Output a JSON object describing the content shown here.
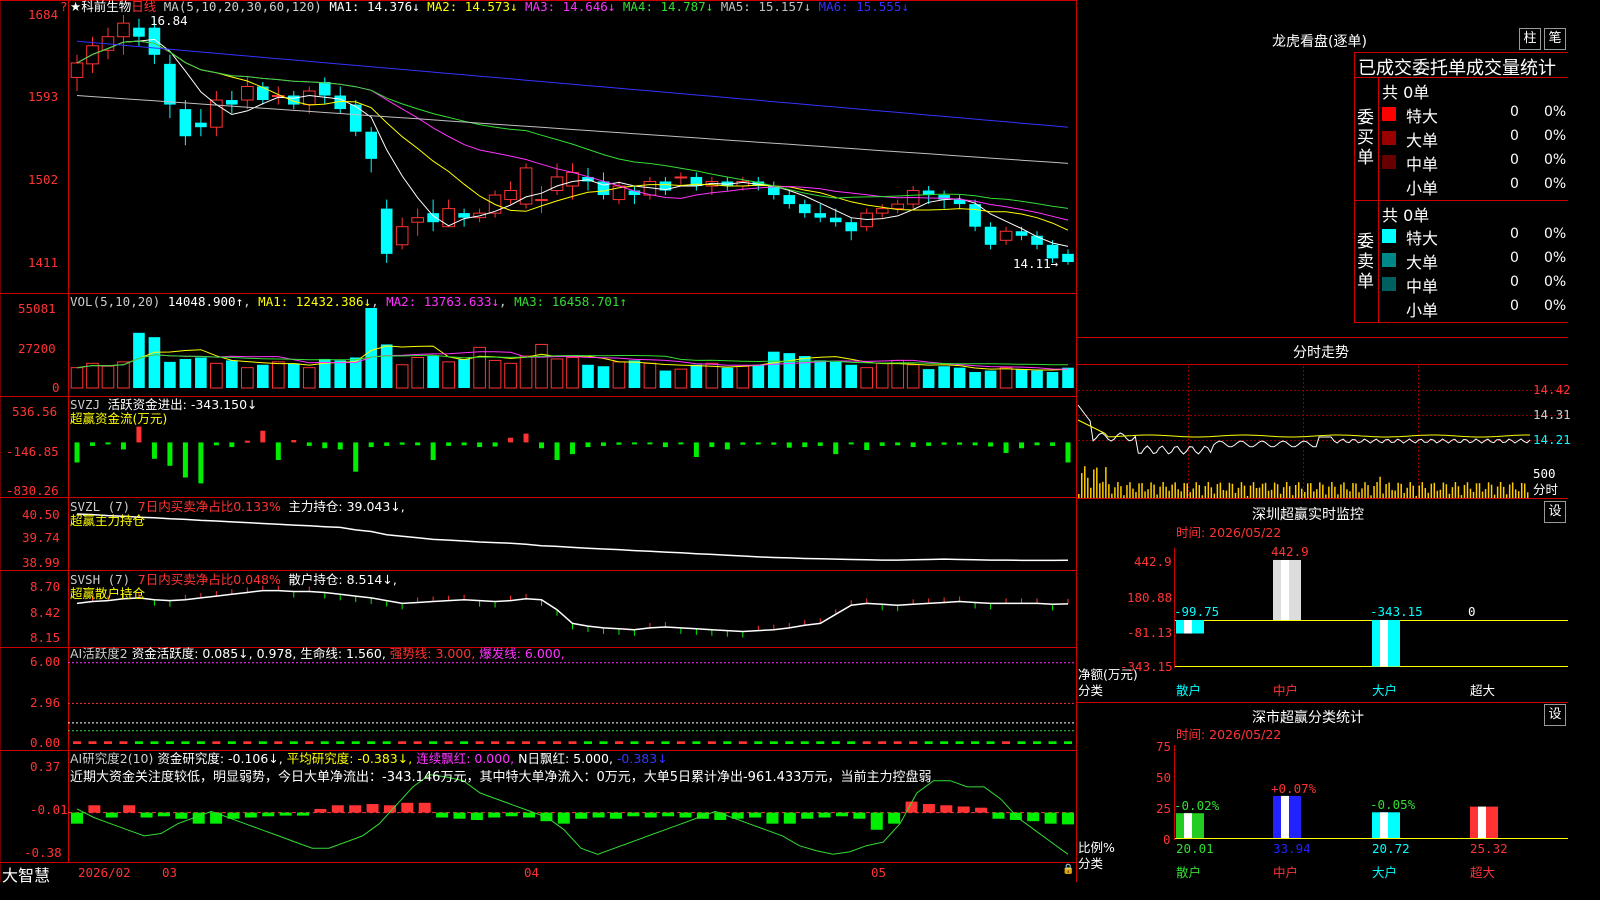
{
  "colors": {
    "up": "#ff3333",
    "down": "#00ffff",
    "ma1": "#ffffff",
    "ma2": "#ffff00",
    "ma3": "#ff33ff",
    "ma4": "#33dd33",
    "ma5": "#c0c0c0",
    "ma6": "#3333ff",
    "frame": "#cc0000",
    "green": "#00ee00"
  },
  "price_panel": {
    "title": "★科前生物",
    "period": "日线",
    "ma_header": "MA(5,10,20,30,60,120)",
    "ma": [
      {
        "label": "MA1: 14.376↓",
        "color": "#ffffff"
      },
      {
        "label": "MA2: 14.573↓",
        "color": "#ffff00"
      },
      {
        "label": "MA3: 14.646↓",
        "color": "#ff33ff"
      },
      {
        "label": "MA4: 14.787↓",
        "color": "#33dd33"
      },
      {
        "label": "MA5: 15.157↓",
        "color": "#c0c0c0"
      },
      {
        "label": "MA6: 15.555↓",
        "color": "#3333ff"
      }
    ],
    "y_ticks": [
      "1684",
      "1593",
      "1502",
      "1411"
    ],
    "high_marker": "16.84",
    "last_marker": "14.11→",
    "y_range": [
      14.11,
      16.84
    ]
  },
  "candles": [
    [
      16.15,
      16.31,
      16.0,
      16.4
    ],
    [
      16.3,
      16.5,
      16.2,
      16.6
    ],
    [
      16.45,
      16.6,
      16.35,
      16.7
    ],
    [
      16.6,
      16.75,
      16.4,
      16.84
    ],
    [
      16.7,
      16.6,
      16.5,
      16.8
    ],
    [
      16.7,
      16.4,
      16.3,
      16.8
    ],
    [
      16.3,
      15.85,
      15.7,
      16.4
    ],
    [
      15.8,
      15.5,
      15.4,
      15.9
    ],
    [
      15.65,
      15.6,
      15.5,
      15.8
    ],
    [
      15.6,
      15.9,
      15.5,
      16.0
    ],
    [
      15.9,
      15.85,
      15.75,
      16.0
    ],
    [
      15.9,
      16.05,
      15.8,
      16.15
    ],
    [
      16.05,
      15.9,
      15.85,
      16.1
    ],
    [
      15.95,
      15.95,
      15.85,
      16.05
    ],
    [
      15.95,
      15.85,
      15.8,
      16.0
    ],
    [
      15.85,
      16.0,
      15.75,
      16.05
    ],
    [
      16.1,
      15.95,
      15.85,
      16.15
    ],
    [
      15.95,
      15.8,
      15.75,
      16.05
    ],
    [
      15.85,
      15.55,
      15.5,
      15.9
    ],
    [
      15.55,
      15.25,
      15.1,
      15.6
    ],
    [
      14.7,
      14.2,
      14.1,
      14.8
    ],
    [
      14.3,
      14.5,
      14.25,
      14.6
    ],
    [
      14.55,
      14.6,
      14.4,
      14.7
    ],
    [
      14.65,
      14.55,
      14.45,
      14.8
    ],
    [
      14.5,
      14.7,
      14.5,
      14.8
    ],
    [
      14.65,
      14.6,
      14.5,
      14.7
    ],
    [
      14.6,
      14.65,
      14.55,
      14.7
    ],
    [
      14.65,
      14.85,
      14.6,
      14.9
    ],
    [
      14.8,
      14.9,
      14.75,
      15.0
    ],
    [
      14.75,
      15.15,
      14.7,
      15.2
    ],
    [
      14.8,
      14.8,
      14.65,
      14.95
    ],
    [
      14.9,
      15.05,
      14.85,
      15.2
    ],
    [
      14.95,
      15.1,
      14.8,
      15.2
    ],
    [
      15.05,
      15.0,
      14.9,
      15.15
    ],
    [
      15.0,
      14.85,
      14.8,
      15.1
    ],
    [
      14.8,
      14.95,
      14.75,
      15.0
    ],
    [
      14.9,
      14.85,
      14.75,
      14.95
    ],
    [
      14.85,
      15.0,
      14.8,
      15.05
    ],
    [
      15.0,
      14.9,
      14.85,
      15.05
    ],
    [
      15.05,
      15.05,
      14.95,
      15.1
    ],
    [
      15.05,
      14.95,
      14.9,
      15.1
    ],
    [
      14.95,
      15.0,
      14.85,
      15.05
    ],
    [
      15.0,
      14.95,
      14.9,
      15.05
    ],
    [
      14.95,
      15.0,
      14.9,
      15.05
    ],
    [
      15.0,
      14.95,
      14.9,
      15.05
    ],
    [
      14.95,
      14.85,
      14.8,
      15.0
    ],
    [
      14.85,
      14.75,
      14.7,
      14.9
    ],
    [
      14.75,
      14.65,
      14.6,
      14.8
    ],
    [
      14.65,
      14.6,
      14.55,
      14.75
    ],
    [
      14.6,
      14.55,
      14.5,
      14.7
    ],
    [
      14.55,
      14.45,
      14.35,
      14.6
    ],
    [
      14.5,
      14.65,
      14.45,
      14.7
    ],
    [
      14.65,
      14.7,
      14.6,
      14.75
    ],
    [
      14.7,
      14.75,
      14.65,
      14.8
    ],
    [
      14.75,
      14.9,
      14.7,
      14.95
    ],
    [
      14.9,
      14.85,
      14.75,
      14.95
    ],
    [
      14.85,
      14.8,
      14.7,
      14.9
    ],
    [
      14.8,
      14.75,
      14.7,
      14.85
    ],
    [
      14.75,
      14.5,
      14.45,
      14.8
    ],
    [
      14.5,
      14.3,
      14.25,
      14.55
    ],
    [
      14.35,
      14.45,
      14.3,
      14.5
    ],
    [
      14.45,
      14.4,
      14.35,
      14.5
    ],
    [
      14.4,
      14.3,
      14.25,
      14.45
    ],
    [
      14.3,
      14.15,
      14.1,
      14.35
    ],
    [
      14.2,
      14.11,
      14.08,
      14.25
    ]
  ],
  "vol_panel": {
    "title": "VOL(5,10,20)",
    "v0": "14048.900↑",
    "ma1": "MA1: 12432.386↓",
    "ma2": "MA2: 13763.633↓",
    "ma3": "MA3: 16458.701↑",
    "y_ticks": [
      "55081",
      "27200",
      "0"
    ],
    "y_max": 55081,
    "values": [
      14000,
      17000,
      15000,
      18000,
      38000,
      35000,
      18000,
      20000,
      21000,
      17000,
      19000,
      14000,
      16000,
      18000,
      17000,
      14000,
      20000,
      19000,
      21000,
      55081,
      30000,
      16000,
      21000,
      22000,
      18000,
      20000,
      28000,
      19000,
      17000,
      22000,
      30000,
      20000,
      21000,
      16000,
      15000,
      18000,
      19000,
      17000,
      12000,
      13000,
      16000,
      17000,
      14000,
      15000,
      16000,
      25000,
      24000,
      22000,
      19000,
      18000,
      16000,
      14000,
      17000,
      19000,
      16000,
      13000,
      15000,
      14000,
      11000,
      12000,
      14000,
      13000,
      12000,
      11000,
      14000
    ]
  },
  "svzj": {
    "title": "SVZJ",
    "sub": "活跃资金进出: -343.150↓",
    "label": "超赢资金流(万元)",
    "y_ticks": [
      "536.56",
      "-146.85",
      "-830.26"
    ],
    "y_range": [
      -830.26,
      536.56
    ],
    "values": [
      -343,
      -60,
      -30,
      -120,
      270,
      -280,
      -400,
      -600,
      -700,
      -50,
      -80,
      30,
      200,
      -300,
      40,
      -60,
      -100,
      -120,
      -500,
      -80,
      -60,
      -40,
      -50,
      -300,
      -60,
      -50,
      -80,
      -70,
      80,
      150,
      -100,
      -300,
      -200,
      -80,
      -60,
      -40,
      -30,
      -30,
      -80,
      -30,
      -250,
      -80,
      -120,
      -40,
      -20,
      -40,
      -90,
      -80,
      -60,
      -200,
      -30,
      -130,
      -60,
      -50,
      -80,
      -60,
      -40,
      -40,
      -50,
      -70,
      -180,
      -100,
      -50,
      -60,
      -343
    ]
  },
  "svzl": {
    "title": "SVZL (7)",
    "sub1": "7日内买卖净占比0.133%",
    "sub2": "主力持仓: 39.043↓,",
    "label": "超赢主力持仓",
    "y_ticks": [
      "40.50",
      "39.74",
      "38.99"
    ],
    "y_range": [
      38.99,
      40.5
    ],
    "values": [
      40.5,
      40.48,
      40.45,
      40.43,
      40.4,
      40.38,
      40.35,
      40.33,
      40.3,
      40.28,
      40.25,
      40.23,
      40.2,
      40.18,
      40.15,
      40.13,
      40.1,
      40.08,
      40.0,
      39.95,
      39.85,
      39.8,
      39.75,
      39.7,
      39.68,
      39.65,
      39.62,
      39.6,
      39.58,
      39.55,
      39.5,
      39.48,
      39.45,
      39.42,
      39.4,
      39.38,
      39.35,
      39.33,
      39.3,
      39.28,
      39.25,
      39.23,
      39.2,
      39.18,
      39.15,
      39.13,
      39.12,
      39.1,
      39.09,
      39.08,
      39.07,
      39.06,
      39.05,
      39.05,
      39.06,
      39.07,
      39.08,
      39.07,
      39.06,
      39.05,
      39.05,
      39.04,
      39.04,
      39.04,
      39.043
    ]
  },
  "svsh": {
    "title": "SVSH (7)",
    "sub1": "7日内买卖净占比0.048%",
    "sub2": "散户持仓: 8.514↓,",
    "label": "超赢散户持仓",
    "y_ticks": [
      "8.70",
      "8.42",
      "8.15"
    ],
    "y_range": [
      8.15,
      8.7
    ],
    "values": [
      8.52,
      8.54,
      8.55,
      8.57,
      8.58,
      8.56,
      8.55,
      8.56,
      8.58,
      8.6,
      8.62,
      8.64,
      8.66,
      8.66,
      8.65,
      8.65,
      8.64,
      8.62,
      8.6,
      8.58,
      8.55,
      8.52,
      8.53,
      8.54,
      8.55,
      8.56,
      8.55,
      8.54,
      8.55,
      8.57,
      8.56,
      8.45,
      8.3,
      8.27,
      8.25,
      8.24,
      8.23,
      8.25,
      8.26,
      8.25,
      8.24,
      8.23,
      8.22,
      8.21,
      8.22,
      8.23,
      8.25,
      8.28,
      8.3,
      8.4,
      8.5,
      8.52,
      8.51,
      8.5,
      8.51,
      8.52,
      8.53,
      8.54,
      8.53,
      8.52,
      8.52,
      8.52,
      8.52,
      8.51,
      8.514
    ]
  },
  "ai1": {
    "title": "AI活跃度2",
    "sub1": "资金活跃度: 0.085↓,",
    "sub2": "0.978,",
    "sub3": "生命线: 1.560,",
    "sub4": "强势线: 3.000,",
    "sub5": "爆发线: 6.000,",
    "y_ticks": [
      "6.00",
      "2.96",
      "0.00"
    ],
    "y_range": [
      0,
      6.2
    ]
  },
  "ai2": {
    "title": "AI研究度2(10)",
    "sub1": "资金研究度: -0.106↓,",
    "sub2": "平均研究度: -0.383↓,",
    "sub3": "连续飘红: 0.000,",
    "sub4": "N日飘红: 5.000,",
    "sub5": "-0.383↓",
    "comment": "近期大资金关注度较低，明显弱势，今日大单净流出：-343.146万元，其中特大单净流入：0万元，大单5日累计净出-961.433万元，当前主力控盘弱",
    "y_ticks": [
      "0.37",
      "-0.01",
      "-0.38"
    ],
    "y_range": [
      -0.38,
      0.37
    ],
    "values": [
      -0.1,
      0.05,
      -0.05,
      0.05,
      -0.05,
      -0.04,
      -0.06,
      -0.1,
      -0.1,
      -0.06,
      -0.05,
      -0.04,
      -0.03,
      -0.03,
      0.02,
      0.05,
      0.05,
      0.06,
      0.05,
      0.07,
      0.07,
      -0.05,
      -0.06,
      -0.07,
      -0.05,
      -0.04,
      -0.05,
      -0.08,
      -0.1,
      -0.06,
      -0.05,
      -0.06,
      -0.04,
      -0.05,
      -0.04,
      -0.05,
      -0.06,
      -0.07,
      -0.06,
      -0.05,
      -0.1,
      -0.1,
      -0.06,
      -0.05,
      -0.04,
      -0.06,
      -0.15,
      -0.1,
      0.08,
      0.06,
      0.05,
      0.04,
      0.03,
      -0.06,
      -0.07,
      -0.08,
      -0.1,
      -0.106
    ],
    "line": [
      0.02,
      -0.05,
      -0.1,
      -0.15,
      -0.2,
      -0.18,
      -0.1,
      -0.05,
      0.0,
      -0.05,
      -0.1,
      -0.15,
      -0.2,
      -0.25,
      -0.3,
      -0.3,
      -0.25,
      -0.2,
      -0.1,
      0.05,
      0.2,
      0.3,
      0.28,
      0.25,
      0.15,
      0.1,
      0.05,
      0.0,
      -0.05,
      -0.15,
      -0.3,
      -0.35,
      -0.3,
      -0.25,
      -0.2,
      -0.15,
      -0.1,
      -0.05,
      0.0,
      -0.05,
      -0.1,
      -0.15,
      -0.2,
      -0.28,
      -0.32,
      -0.35,
      -0.33,
      -0.28,
      -0.25,
      -0.1,
      0.15,
      0.25,
      0.25,
      0.2,
      0.2,
      0.1,
      -0.05,
      -0.15,
      -0.25,
      -0.35
    ]
  },
  "date_axis": {
    "brand": "大智慧",
    "labels": [
      "2026/02",
      "03",
      "04",
      "05"
    ]
  },
  "right": {
    "lhb_title": "龙虎看盘(逐单)",
    "btn_zhu": "柱",
    "btn_bi": "笔",
    "stat_title": "已成交委托单成交量统计",
    "buy_group": "委买单",
    "sell_group": "委卖单",
    "buy_total": "共 0单",
    "sell_total": "共 0单",
    "buy_rows": [
      {
        "name": "特大",
        "n": "0",
        "p": "0%",
        "c": "#ff0000"
      },
      {
        "name": "大单",
        "n": "0",
        "p": "0%",
        "c": "#990000"
      },
      {
        "name": "中单",
        "n": "0",
        "p": "0%",
        "c": "#660000"
      },
      {
        "name": "小单",
        "n": "0",
        "p": "0%",
        "c": "#000000"
      }
    ],
    "sell_rows": [
      {
        "name": "特大",
        "n": "0",
        "p": "0%",
        "c": "#00ffff"
      },
      {
        "name": "大单",
        "n": "0",
        "p": "0%",
        "c": "#008888"
      },
      {
        "name": "中单",
        "n": "0",
        "p": "0%",
        "c": "#005f5f"
      },
      {
        "name": "小单",
        "n": "0",
        "p": "0%",
        "c": "#000000"
      }
    ],
    "fs_title": "分时走势",
    "fs_y": [
      "14.42",
      "14.31",
      "14.21",
      "500",
      "分时"
    ],
    "sz_title": "深圳超赢实时监控",
    "sz_btn": "设",
    "sz_date": "时间: 2026/05/22",
    "sz_y": [
      "442.9",
      "180.88",
      "-81.13",
      "-343.15"
    ],
    "sz_bars": [
      {
        "cat": "散户",
        "val": "-99.75",
        "v": -99.75,
        "color": "#00ffff"
      },
      {
        "cat": "中户",
        "val": "442.9",
        "v": 442.9,
        "color": "#dddddd"
      },
      {
        "cat": "大户",
        "val": "-343.15",
        "v": -343.15,
        "color": "#00ffff"
      },
      {
        "cat": "超大",
        "val": "0",
        "v": 0,
        "color": "#ffffff"
      }
    ],
    "sz_ylabel1": "净额(万元)",
    "sz_ylabel2": "分类",
    "cls_title": "深市超赢分类统计",
    "cls_btn": "设",
    "cls_date": "时间: 2026/05/22",
    "cls_y": [
      "75",
      "50",
      "25",
      "0"
    ],
    "cls_bars": [
      {
        "cat": "散户",
        "val": "20.01",
        "v": 20.01,
        "chg": "-0.02%",
        "color": "#22cc22"
      },
      {
        "cat": "中户",
        "val": "33.94",
        "v": 33.94,
        "chg": "+0.07%",
        "color": "#2222ff"
      },
      {
        "cat": "大户",
        "val": "20.72",
        "v": 20.72,
        "chg": "-0.05%",
        "color": "#00ffff"
      },
      {
        "cat": "超大",
        "val": "25.32",
        "v": 25.32,
        "chg": "",
        "color": "#ff3333"
      }
    ],
    "cls_ylabel1": "比例%",
    "cls_ylabel2": "分类"
  }
}
